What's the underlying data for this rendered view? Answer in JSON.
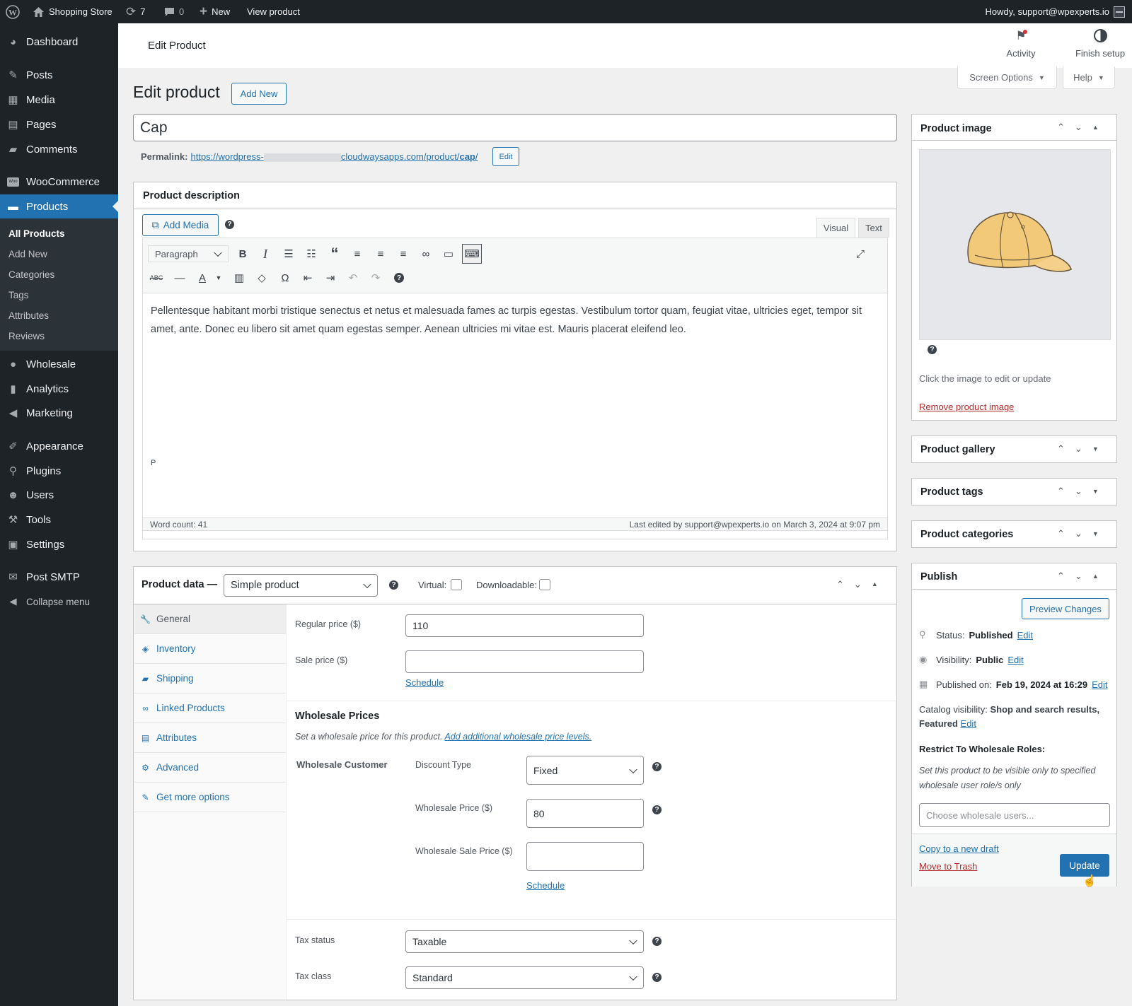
{
  "adminbar": {
    "site_name": "Shopping Store",
    "updates": "7",
    "comments": "0",
    "new_label": "New",
    "view_label": "View product",
    "howdy": "Howdy, support@wpexperts.io"
  },
  "sidebar": {
    "dashboard": "Dashboard",
    "posts": "Posts",
    "media": "Media",
    "pages": "Pages",
    "comments": "Comments",
    "woocommerce": "WooCommerce",
    "products": "Products",
    "sub": [
      "All Products",
      "Add New",
      "Categories",
      "Tags",
      "Attributes",
      "Reviews"
    ],
    "wholesale": "Wholesale",
    "analytics": "Analytics",
    "marketing": "Marketing",
    "appearance": "Appearance",
    "plugins": "Plugins",
    "users": "Users",
    "tools": "Tools",
    "settings": "Settings",
    "post_smtp": "Post SMTP",
    "collapse": "Collapse menu"
  },
  "topbar": {
    "title": "Edit Product",
    "activity": "Activity",
    "finish_setup": "Finish setup"
  },
  "screen_options": "Screen Options",
  "help": "Help",
  "page": {
    "heading": "Edit product",
    "add_new": "Add New",
    "title_value": "Cap",
    "permalink_label": "Permalink:",
    "permalink_prefix": "https://wordpress-",
    "permalink_suffix": "cloudwaysapps.com/product/",
    "permalink_slug": "cap",
    "permalink_end": "/",
    "permalink_edit": "Edit"
  },
  "description": {
    "title": "Product description",
    "add_media": "Add Media",
    "tab_visual": "Visual",
    "tab_text": "Text",
    "format": "Paragraph",
    "content": "Pellentesque habitant morbi tristique senectus et netus et malesuada fames ac turpis egestas. Vestibulum tortor quam, feugiat vitae, ultricies eget, tempor sit amet, ante. Donec eu libero sit amet quam egestas semper. Aenean ultricies mi vitae est. Mauris placerat eleifend leo.",
    "path": "P",
    "word_count": "Word count: 41",
    "last_edited": "Last edited by support@wpexperts.io on March 3, 2024 at 9:07 pm"
  },
  "product_data": {
    "label": "Product data —",
    "type": "Simple product",
    "virtual": "Virtual:",
    "downloadable": "Downloadable:",
    "tabs": [
      "General",
      "Inventory",
      "Shipping",
      "Linked Products",
      "Attributes",
      "Advanced",
      "Get more options"
    ],
    "regular_price_label": "Regular price ($)",
    "regular_price": "110",
    "sale_price_label": "Sale price ($)",
    "sale_price": "",
    "schedule": "Schedule",
    "wholesale_title": "Wholesale Prices",
    "wholesale_desc": "Set a wholesale price for this product.",
    "wholesale_link": "Add additional wholesale price levels.",
    "role": "Wholesale Customer",
    "discount_type_label": "Discount Type",
    "discount_type": "Fixed",
    "wholesale_price_label": "Wholesale Price ($)",
    "wholesale_price": "80",
    "wholesale_sale_label": "Wholesale Sale Price ($)",
    "wholesale_sale": "",
    "schedule2": "Schedule",
    "tax_status_label": "Tax status",
    "tax_status": "Taxable",
    "tax_class_label": "Tax class",
    "tax_class": "Standard"
  },
  "image_box": {
    "title": "Product image",
    "hint": "Click the image to edit or update",
    "remove": "Remove product image"
  },
  "gallery": {
    "title": "Product gallery"
  },
  "tags": {
    "title": "Product tags"
  },
  "categories": {
    "title": "Product categories"
  },
  "publish": {
    "title": "Publish",
    "preview": "Preview Changes",
    "status_label": "Status:",
    "status": "Published",
    "visibility_label": "Visibility:",
    "visibility": "Public",
    "published_label": "Published on:",
    "published": "Feb 19, 2024 at 16:29",
    "edit": "Edit",
    "catalog_label": "Catalog visibility:",
    "catalog_a": "Shop and search results,",
    "catalog_b": "Featured",
    "restrict_title": "Restrict To Wholesale Roles:",
    "restrict_desc": "Set this product to be visible only to specified wholesale user role/s only",
    "roles_placeholder": "Choose wholesale users...",
    "copy_draft": "Copy to a new draft",
    "trash": "Move to Trash",
    "update": "Update"
  },
  "colors": {
    "accent": "#2271b1",
    "sidebar": "#1d2327",
    "trash": "#b32d2e"
  }
}
